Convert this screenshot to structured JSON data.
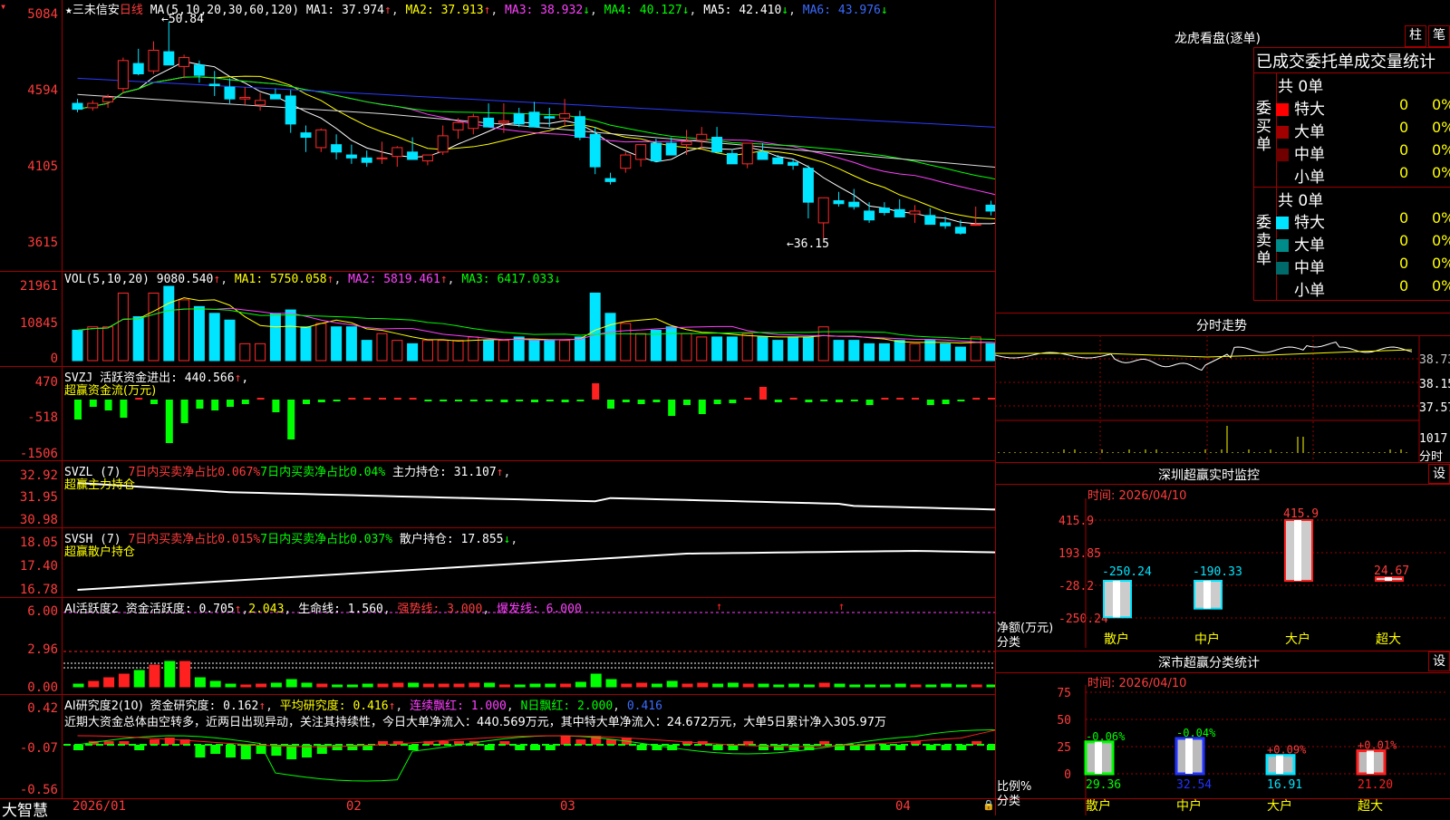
{
  "header": {
    "star": "★",
    "stock_name": "三未信安",
    "period": "日线",
    "ma_label": "MA(5,10,20,30,60,120)",
    "ma1": "MA1: 37.974",
    "ma2": "MA2: 37.913",
    "ma3": "MA3: 38.932",
    "ma4": "MA4: 40.127",
    "ma5": "MA5: 42.410",
    "ma6": "MA6: 43.976",
    "high_mark": "50.84",
    "low_mark": "36.15"
  },
  "price_axis": [
    "5084",
    "4594",
    "4105",
    "3615"
  ],
  "vol": {
    "title": "VOL(5,10,20)",
    "value": "9080.540",
    "ma1": "MA1: 5750.058",
    "ma2": "MA2: 5819.461",
    "ma3": "MA3: 6417.033",
    "axis": [
      "21961",
      "10845",
      "0"
    ]
  },
  "svzj": {
    "line1": "SVZJ  活跃资金进出: 440.566",
    "line2": "超赢资金流(万元)",
    "axis": [
      "470",
      "-518",
      "-1506"
    ]
  },
  "svzl": {
    "prefix": "SVZL (7)",
    "red": "7日内买卖净占比0.067%",
    "green": "7日内买卖净占比0.04%",
    "main": "主力持仓: 31.107",
    "line2": "超赢主力持仓",
    "axis": [
      "32.92",
      "31.95",
      "30.98"
    ]
  },
  "svsh": {
    "prefix": "SVSH (7)",
    "red": "7日内买卖净占比0.015%",
    "green": "7日内买卖净占比0.037%",
    "main": "散户持仓: 17.855",
    "line2": "超赢散户持仓",
    "axis": [
      "18.05",
      "17.40",
      "16.78"
    ]
  },
  "ai1": {
    "title": "AI活跃度2",
    "active": "资金活跃度: 0.705",
    "v2": "2.043",
    "life": "生命线: 1.560",
    "strong": "强势线: 3.000",
    "burst": "爆发线: 6.000",
    "axis": [
      "6.00",
      "2.96",
      "0.00"
    ]
  },
  "ai2": {
    "title": "AI研究度2(10)",
    "research": "资金研究度: 0.162",
    "avg": "平均研究度: 0.416",
    "cont": "连续飘红: 1.000",
    "nday": "N日飘红: 2.000",
    "val": "0.416",
    "note": "近期大资金总体由空转多，近两日出现异动，关注其持续性，今日大单净流入：440.569万元，其中特大单净流入：24.672万元，大单5日累计净入305.97万",
    "axis": [
      "0.42",
      "-0.07",
      "-0.56"
    ]
  },
  "date_axis": [
    "2026/01",
    "02",
    "03",
    "04"
  ],
  "footer_logo": "大智慧",
  "right": {
    "longhu_title": "龙虎看盘(逐单)",
    "btn_zhu": "柱",
    "btn_bi": "笔",
    "stats_title": "已成交委托单成交量统计",
    "buy_label": "委买单",
    "sell_label": "委卖单",
    "buy_total": "共 0单",
    "sell_total": "共 0单",
    "buy_rows": [
      {
        "name": "特大",
        "count": "0",
        "pct": "0%",
        "color": "#ff0000"
      },
      {
        "name": "大单",
        "count": "0",
        "pct": "0%",
        "color": "#a00000"
      },
      {
        "name": "中单",
        "count": "0",
        "pct": "0%",
        "color": "#700000"
      },
      {
        "name": "小单",
        "count": "0",
        "pct": "0%",
        "color": ""
      }
    ],
    "sell_rows": [
      {
        "name": "特大",
        "count": "0",
        "pct": "0%",
        "color": "#00e5ff"
      },
      {
        "name": "大单",
        "count": "0",
        "pct": "0%",
        "color": "#008b8b"
      },
      {
        "name": "中单",
        "count": "0",
        "pct": "0%",
        "color": "#006a6a"
      },
      {
        "name": "小单",
        "count": "0",
        "pct": "0%",
        "color": ""
      }
    ],
    "fenshi_title": "分时走势",
    "fenshi_axis": [
      "38.73",
      "38.15",
      "37.57",
      "1017"
    ],
    "fenshi_unit": "分时",
    "sz_monitor_title": "深圳超赢实时监控",
    "sz_set": "设",
    "sz_time": "时间: 2026/04/10",
    "sz_axis": [
      "415.9",
      "193.85",
      "-28.2",
      "-250.24"
    ],
    "sz_y_label": "净额(万元)",
    "sz_x_label": "分类",
    "sz_bars": [
      {
        "cat": "散户",
        "value": -250.24,
        "label": "-250.24"
      },
      {
        "cat": "中户",
        "value": -190.33,
        "label": "-190.33"
      },
      {
        "cat": "大户",
        "value": 415.9,
        "label": "415.9"
      },
      {
        "cat": "超大",
        "value": 24.67,
        "label": "24.67"
      }
    ],
    "sz_class_title": "深市超赢分类统计",
    "sz_class_set": "设",
    "sz_class_time": "时间: 2026/04/10",
    "sz_class_axis": [
      "75",
      "50",
      "25",
      "0"
    ],
    "sz_class_y_label": "比例%",
    "sz_class_x_label": "分类",
    "sz_class_bars": [
      {
        "cat": "散户",
        "value": 29.36,
        "label": "29.36",
        "chg": "-0.06%",
        "color": "#00ff00"
      },
      {
        "cat": "中户",
        "value": 32.54,
        "label": "32.54",
        "chg": "-0.04%",
        "color": "#2233ff"
      },
      {
        "cat": "大户",
        "value": 16.91,
        "label": "16.91",
        "chg": "+0.09%",
        "color": "#00e5ff"
      },
      {
        "cat": "超大",
        "value": 21.2,
        "label": "21.20",
        "chg": "+0.01%",
        "color": "#ff2020"
      }
    ]
  },
  "chart_data": {
    "type": "candlestick",
    "candles": [
      [
        45.3,
        45.6,
        44.7,
        44.9
      ],
      [
        45.0,
        45.5,
        44.8,
        45.3
      ],
      [
        45.4,
        45.9,
        45.0,
        45.7
      ],
      [
        46.3,
        48.4,
        46.0,
        48.2
      ],
      [
        48.0,
        49.0,
        47.2,
        47.3
      ],
      [
        47.5,
        49.5,
        47.3,
        48.9
      ],
      [
        48.8,
        50.84,
        48.0,
        47.9
      ],
      [
        47.8,
        48.6,
        47.0,
        48.4
      ],
      [
        47.9,
        48.2,
        46.7,
        47.2
      ],
      [
        46.6,
        47.5,
        45.8,
        46.5
      ],
      [
        46.4,
        47.0,
        45.3,
        45.6
      ],
      [
        45.6,
        46.4,
        45.2,
        45.7
      ],
      [
        45.2,
        46.0,
        44.8,
        45.5
      ],
      [
        45.9,
        46.3,
        45.6,
        45.6
      ],
      [
        45.8,
        46.2,
        43.3,
        43.9
      ],
      [
        43.3,
        43.8,
        42.0,
        43.0
      ],
      [
        42.3,
        43.6,
        42.0,
        43.5
      ],
      [
        42.5,
        43.2,
        41.5,
        42.0
      ],
      [
        41.8,
        42.5,
        41.2,
        41.6
      ],
      [
        41.6,
        42.1,
        41.0,
        41.3
      ],
      [
        41.6,
        42.7,
        41.2,
        41.6
      ],
      [
        41.7,
        42.4,
        41.0,
        42.3
      ],
      [
        42.0,
        43.0,
        41.5,
        41.5
      ],
      [
        41.4,
        41.8,
        41.1,
        41.8
      ],
      [
        42.0,
        43.8,
        41.8,
        43.1
      ],
      [
        43.5,
        44.3,
        42.9,
        44.0
      ],
      [
        43.6,
        44.6,
        43.2,
        44.4
      ],
      [
        44.3,
        45.3,
        43.8,
        43.7
      ],
      [
        44.0,
        45.3,
        43.3,
        44.1
      ],
      [
        44.6,
        45.0,
        43.7,
        43.9
      ],
      [
        44.7,
        45.4,
        43.9,
        43.7
      ],
      [
        44.4,
        45.0,
        43.7,
        44.3
      ],
      [
        44.3,
        45.6,
        43.8,
        44.6
      ],
      [
        44.4,
        44.8,
        42.8,
        43.0
      ],
      [
        43.2,
        43.7,
        40.5,
        41.0
      ],
      [
        40.2,
        40.6,
        39.8,
        40.0
      ],
      [
        40.9,
        42.0,
        40.6,
        41.8
      ],
      [
        41.5,
        42.3,
        41.0,
        42.5
      ],
      [
        42.6,
        42.9,
        41.3,
        41.4
      ],
      [
        42.6,
        43.0,
        42.0,
        41.8
      ],
      [
        42.5,
        43.5,
        41.8,
        42.7
      ],
      [
        42.8,
        43.7,
        42.2,
        43.2
      ],
      [
        43.0,
        43.7,
        42.6,
        42.0
      ],
      [
        41.9,
        42.2,
        41.4,
        41.2
      ],
      [
        41.2,
        42.6,
        40.9,
        42.6
      ],
      [
        42.0,
        42.6,
        41.5,
        41.5
      ],
      [
        41.6,
        41.8,
        41.2,
        41.2
      ],
      [
        41.3,
        41.5,
        40.8,
        41.1
      ],
      [
        40.9,
        41.1,
        37.5,
        38.6
      ],
      [
        37.2,
        37.8,
        36.15,
        38.9
      ],
      [
        38.7,
        39.3,
        38.3,
        38.5
      ],
      [
        38.6,
        39.5,
        38.1,
        38.3
      ],
      [
        38.0,
        38.6,
        37.2,
        37.4
      ],
      [
        38.2,
        38.6,
        37.7,
        37.9
      ],
      [
        38.1,
        38.8,
        37.6,
        37.6
      ],
      [
        37.8,
        38.4,
        37.2,
        38.0
      ],
      [
        37.7,
        38.2,
        37.3,
        37.1
      ],
      [
        37.2,
        37.6,
        36.8,
        37.0
      ],
      [
        36.9,
        37.4,
        36.4,
        36.5
      ],
      [
        37.1,
        38.3,
        37.0,
        37.1
      ],
      [
        38.4,
        38.7,
        37.7,
        38.0
      ],
      [
        38.3,
        38.8,
        37.8,
        37.8
      ],
      [
        38.1,
        38.8,
        37.9,
        38.5
      ]
    ],
    "volume": [
      9,
      10,
      10,
      20,
      13,
      20,
      22,
      18,
      16,
      14,
      12,
      5,
      5,
      14,
      15,
      10,
      11,
      10,
      10,
      6,
      8,
      6,
      5,
      6,
      6,
      6,
      7,
      6,
      6,
      7,
      6,
      6,
      6,
      7,
      20,
      14,
      11,
      8,
      9,
      10,
      8,
      7,
      7,
      7,
      8,
      7,
      6,
      7,
      7,
      10,
      6,
      6,
      5,
      5,
      6,
      5,
      6,
      5,
      4,
      7,
      5,
      5,
      8
    ]
  }
}
